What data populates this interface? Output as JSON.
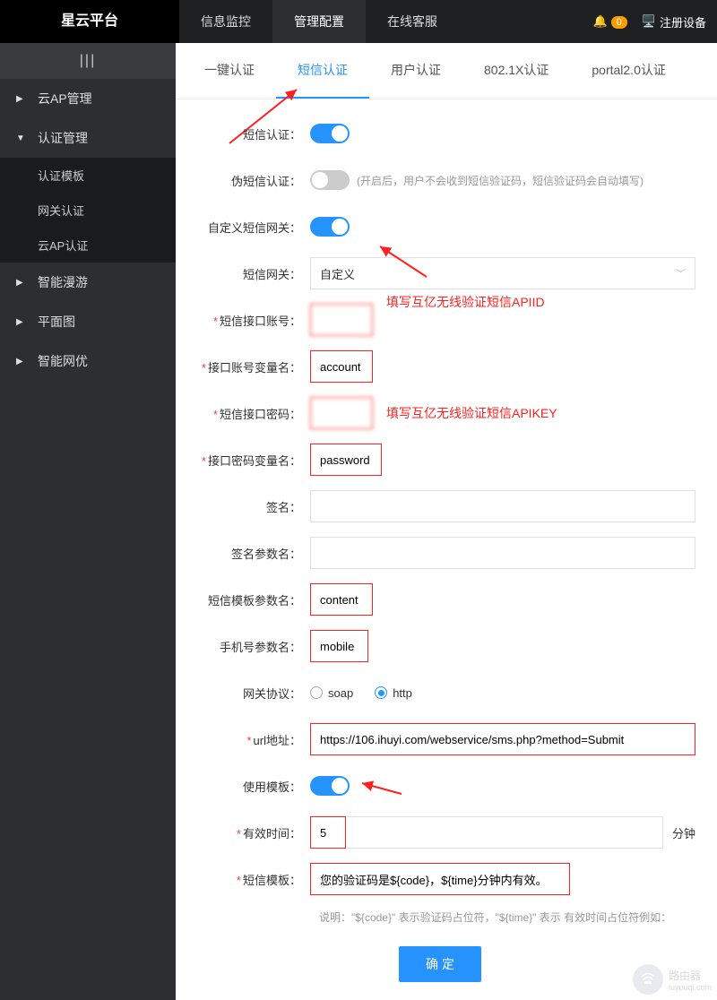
{
  "header": {
    "brand": "星云平台",
    "nav": [
      "信息监控",
      "管理配置",
      "在线客服"
    ],
    "active_nav": 1,
    "badge_count": "0",
    "register": "注册设备"
  },
  "sidebar": {
    "collapse_glyph": "|||",
    "items": [
      {
        "label": "云AP管理",
        "expanded": false
      },
      {
        "label": "认证管理",
        "expanded": true,
        "children": [
          "认证模板",
          "网关认证",
          "云AP认证"
        ]
      },
      {
        "label": "智能漫游",
        "expanded": false
      },
      {
        "label": "平面图",
        "expanded": false
      },
      {
        "label": "智能网优",
        "expanded": false
      }
    ]
  },
  "tabs": {
    "items": [
      "一键认证",
      "短信认证",
      "用户认证",
      "802.1X认证",
      "portal2.0认证"
    ],
    "active": 1
  },
  "form": {
    "sms_auth_label": "短信认证：",
    "fake_sms_label": "伪短信认证：",
    "fake_sms_hint": "(开启后，用户不会收到短信验证码，短信验证码会自动填写)",
    "custom_gateway_label": "自定义短信网关：",
    "gateway_label": "短信网关：",
    "gateway_value": "自定义",
    "api_account_label": "短信接口账号：",
    "api_account_value": "",
    "api_account_annot": "填写互亿无线验证短信APIID",
    "account_var_label": "接口账号变量名：",
    "account_var_value": "account",
    "api_password_label": "短信接口密码：",
    "api_password_value": "",
    "api_password_annot": "填写互亿无线验证短信APIKEY",
    "password_var_label": "接口密码变量名：",
    "password_var_value": "password",
    "sign_label": "签名：",
    "sign_param_label": "签名参数名：",
    "tpl_param_label": "短信模板参数名：",
    "tpl_param_value": "content",
    "mobile_param_label": "手机号参数名：",
    "mobile_param_value": "mobile",
    "protocol_label": "网关协议：",
    "protocol_options": [
      "soap",
      "http"
    ],
    "protocol_selected": "http",
    "url_label": "url地址：",
    "url_value": "https://106.ihuyi.com/webservice/sms.php?method=Submit",
    "use_template_label": "使用模板：",
    "expire_label": "有效时间：",
    "expire_value": "5",
    "expire_unit": "分钟",
    "sms_template_label": "短信模板：",
    "sms_template_value": "您的验证码是${code}，${time}分钟内有效。",
    "template_desc": "说明：\"${code}\" 表示验证码占位符，\"${time}\" 表示 有效时间占位符例如：",
    "submit_label": "确 定"
  },
  "watermark": {
    "title": "路由器",
    "sub": "luyouqi.com"
  }
}
